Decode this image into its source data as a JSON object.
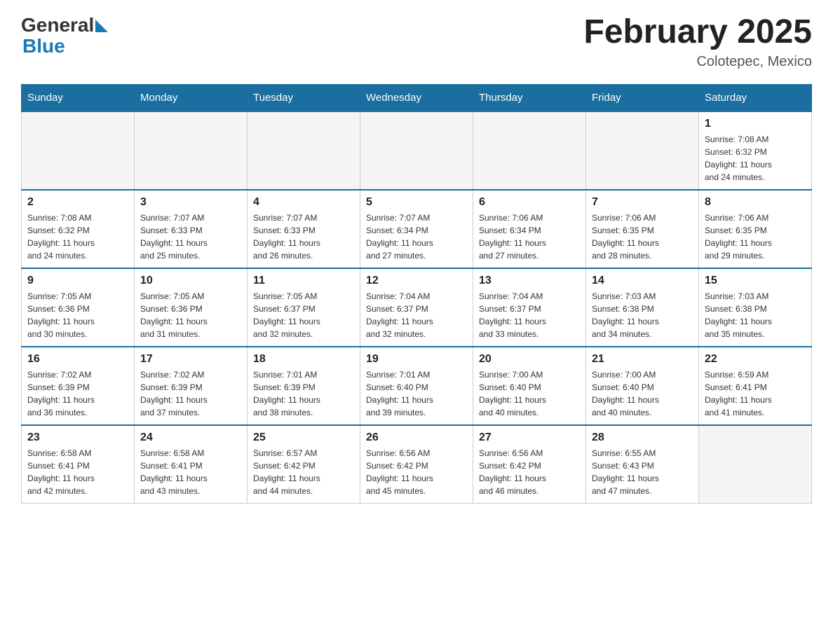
{
  "header": {
    "logo": {
      "general": "General",
      "blue": "Blue",
      "arrow_color": "#1a7ab5"
    },
    "title": "February 2025",
    "location": "Colotepec, Mexico"
  },
  "days_of_week": [
    "Sunday",
    "Monday",
    "Tuesday",
    "Wednesday",
    "Thursday",
    "Friday",
    "Saturday"
  ],
  "weeks": [
    {
      "days": [
        {
          "number": "",
          "info": "",
          "empty": true
        },
        {
          "number": "",
          "info": "",
          "empty": true
        },
        {
          "number": "",
          "info": "",
          "empty": true
        },
        {
          "number": "",
          "info": "",
          "empty": true
        },
        {
          "number": "",
          "info": "",
          "empty": true
        },
        {
          "number": "",
          "info": "",
          "empty": true
        },
        {
          "number": "1",
          "info": "Sunrise: 7:08 AM\nSunset: 6:32 PM\nDaylight: 11 hours\nand 24 minutes.",
          "empty": false
        }
      ]
    },
    {
      "days": [
        {
          "number": "2",
          "info": "Sunrise: 7:08 AM\nSunset: 6:32 PM\nDaylight: 11 hours\nand 24 minutes.",
          "empty": false
        },
        {
          "number": "3",
          "info": "Sunrise: 7:07 AM\nSunset: 6:33 PM\nDaylight: 11 hours\nand 25 minutes.",
          "empty": false
        },
        {
          "number": "4",
          "info": "Sunrise: 7:07 AM\nSunset: 6:33 PM\nDaylight: 11 hours\nand 26 minutes.",
          "empty": false
        },
        {
          "number": "5",
          "info": "Sunrise: 7:07 AM\nSunset: 6:34 PM\nDaylight: 11 hours\nand 27 minutes.",
          "empty": false
        },
        {
          "number": "6",
          "info": "Sunrise: 7:06 AM\nSunset: 6:34 PM\nDaylight: 11 hours\nand 27 minutes.",
          "empty": false
        },
        {
          "number": "7",
          "info": "Sunrise: 7:06 AM\nSunset: 6:35 PM\nDaylight: 11 hours\nand 28 minutes.",
          "empty": false
        },
        {
          "number": "8",
          "info": "Sunrise: 7:06 AM\nSunset: 6:35 PM\nDaylight: 11 hours\nand 29 minutes.",
          "empty": false
        }
      ]
    },
    {
      "days": [
        {
          "number": "9",
          "info": "Sunrise: 7:05 AM\nSunset: 6:36 PM\nDaylight: 11 hours\nand 30 minutes.",
          "empty": false
        },
        {
          "number": "10",
          "info": "Sunrise: 7:05 AM\nSunset: 6:36 PM\nDaylight: 11 hours\nand 31 minutes.",
          "empty": false
        },
        {
          "number": "11",
          "info": "Sunrise: 7:05 AM\nSunset: 6:37 PM\nDaylight: 11 hours\nand 32 minutes.",
          "empty": false
        },
        {
          "number": "12",
          "info": "Sunrise: 7:04 AM\nSunset: 6:37 PM\nDaylight: 11 hours\nand 32 minutes.",
          "empty": false
        },
        {
          "number": "13",
          "info": "Sunrise: 7:04 AM\nSunset: 6:37 PM\nDaylight: 11 hours\nand 33 minutes.",
          "empty": false
        },
        {
          "number": "14",
          "info": "Sunrise: 7:03 AM\nSunset: 6:38 PM\nDaylight: 11 hours\nand 34 minutes.",
          "empty": false
        },
        {
          "number": "15",
          "info": "Sunrise: 7:03 AM\nSunset: 6:38 PM\nDaylight: 11 hours\nand 35 minutes.",
          "empty": false
        }
      ]
    },
    {
      "days": [
        {
          "number": "16",
          "info": "Sunrise: 7:02 AM\nSunset: 6:39 PM\nDaylight: 11 hours\nand 36 minutes.",
          "empty": false
        },
        {
          "number": "17",
          "info": "Sunrise: 7:02 AM\nSunset: 6:39 PM\nDaylight: 11 hours\nand 37 minutes.",
          "empty": false
        },
        {
          "number": "18",
          "info": "Sunrise: 7:01 AM\nSunset: 6:39 PM\nDaylight: 11 hours\nand 38 minutes.",
          "empty": false
        },
        {
          "number": "19",
          "info": "Sunrise: 7:01 AM\nSunset: 6:40 PM\nDaylight: 11 hours\nand 39 minutes.",
          "empty": false
        },
        {
          "number": "20",
          "info": "Sunrise: 7:00 AM\nSunset: 6:40 PM\nDaylight: 11 hours\nand 40 minutes.",
          "empty": false
        },
        {
          "number": "21",
          "info": "Sunrise: 7:00 AM\nSunset: 6:40 PM\nDaylight: 11 hours\nand 40 minutes.",
          "empty": false
        },
        {
          "number": "22",
          "info": "Sunrise: 6:59 AM\nSunset: 6:41 PM\nDaylight: 11 hours\nand 41 minutes.",
          "empty": false
        }
      ]
    },
    {
      "days": [
        {
          "number": "23",
          "info": "Sunrise: 6:58 AM\nSunset: 6:41 PM\nDaylight: 11 hours\nand 42 minutes.",
          "empty": false
        },
        {
          "number": "24",
          "info": "Sunrise: 6:58 AM\nSunset: 6:41 PM\nDaylight: 11 hours\nand 43 minutes.",
          "empty": false
        },
        {
          "number": "25",
          "info": "Sunrise: 6:57 AM\nSunset: 6:42 PM\nDaylight: 11 hours\nand 44 minutes.",
          "empty": false
        },
        {
          "number": "26",
          "info": "Sunrise: 6:56 AM\nSunset: 6:42 PM\nDaylight: 11 hours\nand 45 minutes.",
          "empty": false
        },
        {
          "number": "27",
          "info": "Sunrise: 6:56 AM\nSunset: 6:42 PM\nDaylight: 11 hours\nand 46 minutes.",
          "empty": false
        },
        {
          "number": "28",
          "info": "Sunrise: 6:55 AM\nSunset: 6:43 PM\nDaylight: 11 hours\nand 47 minutes.",
          "empty": false
        },
        {
          "number": "",
          "info": "",
          "empty": true
        }
      ]
    }
  ]
}
